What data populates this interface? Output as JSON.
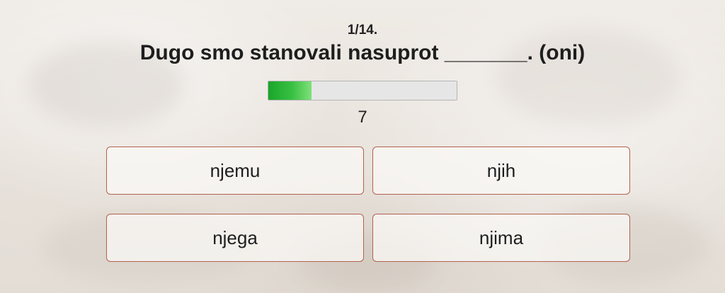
{
  "quiz": {
    "counter": "1/14.",
    "question": "Dugo smo stanovali nasuprot _______. (oni)",
    "progress_fraction": 0.23,
    "timer": "7",
    "answers": [
      {
        "label": "njemu"
      },
      {
        "label": "njih"
      },
      {
        "label": "njega"
      },
      {
        "label": "njima"
      }
    ]
  },
  "colors": {
    "progress_fill": "#2db83a",
    "answer_border": "#b3614c"
  }
}
